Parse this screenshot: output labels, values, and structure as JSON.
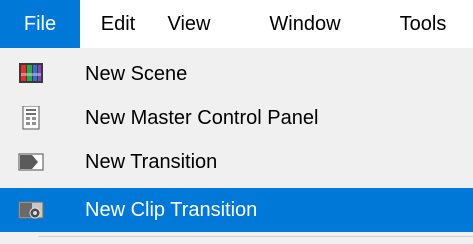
{
  "menubar": {
    "items": [
      {
        "label": "File",
        "active": true
      },
      {
        "label": "Edit",
        "active": false
      },
      {
        "label": "View",
        "active": false
      },
      {
        "label": "Window",
        "active": false
      },
      {
        "label": "Tools",
        "active": false
      }
    ]
  },
  "file_menu": {
    "items": [
      {
        "label": "New Scene",
        "icon": "scene-icon",
        "highlighted": false
      },
      {
        "label": "New Master Control Panel",
        "icon": "control-panel-icon",
        "highlighted": false
      },
      {
        "label": "New Transition",
        "icon": "transition-icon",
        "highlighted": false
      },
      {
        "label": "New Clip Transition",
        "icon": "clip-transition-icon",
        "highlighted": true
      }
    ]
  },
  "colors": {
    "accent": "#0078d7",
    "menu_background": "#f0f0f0",
    "menubar_background": "#ffffff"
  }
}
